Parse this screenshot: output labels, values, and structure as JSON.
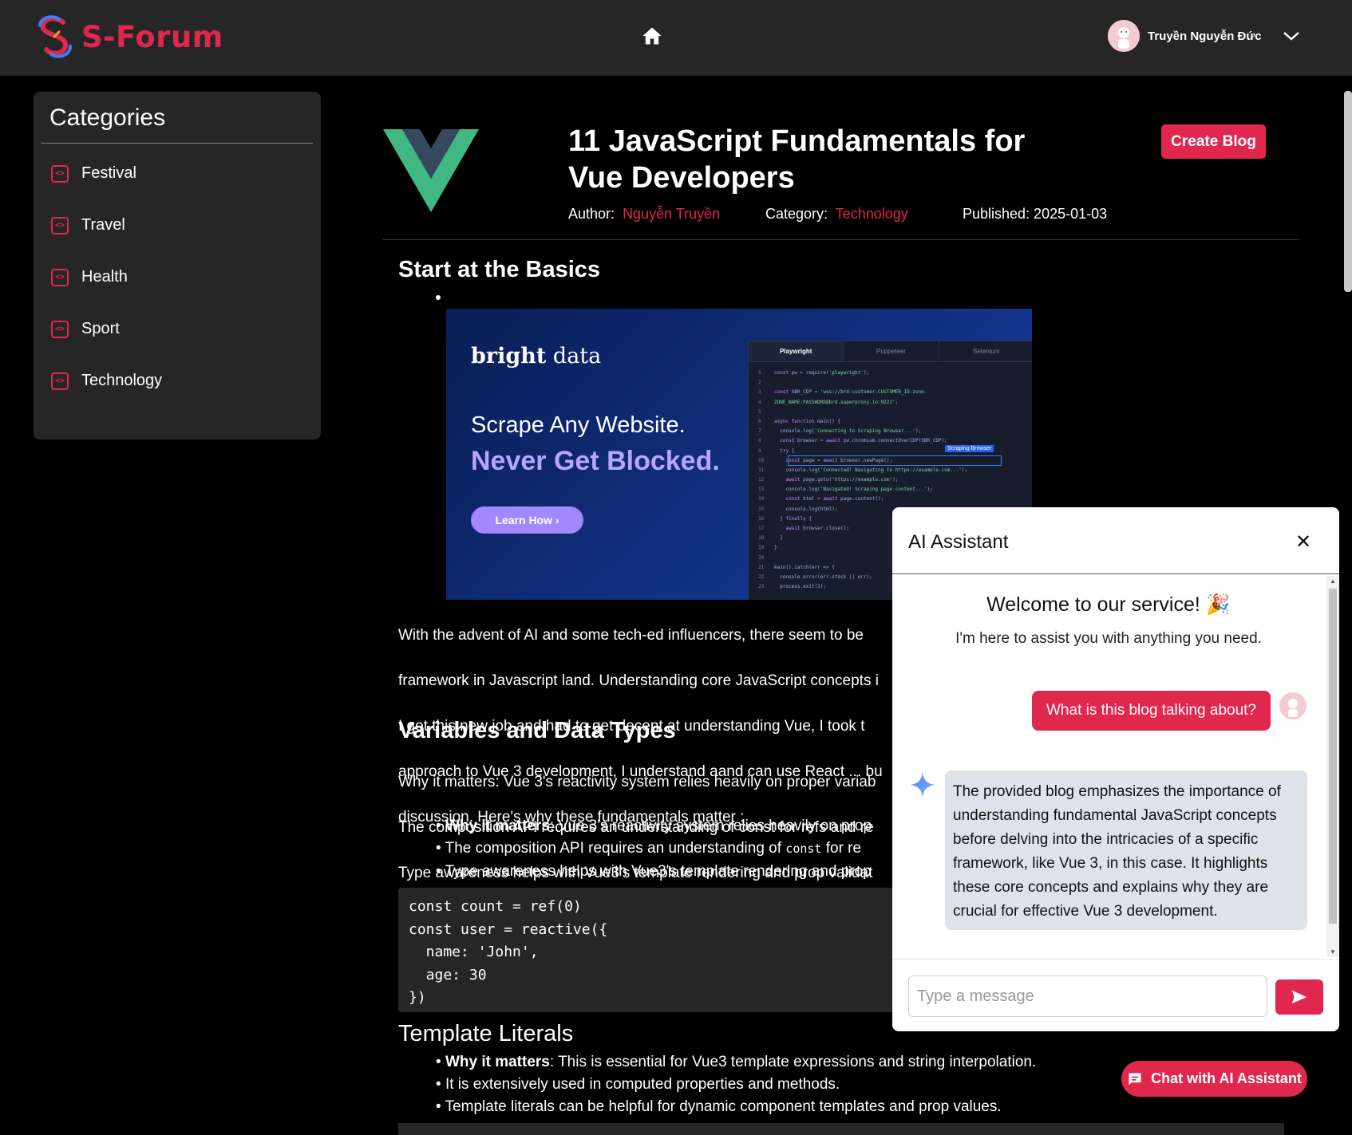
{
  "app": {
    "name": "S-Forum",
    "brand_color": "#e0284f"
  },
  "header": {
    "home_icon": "home-icon",
    "user_name": "Truyền Nguyễn Đức",
    "dropdown_icon": "chevron-down-icon"
  },
  "sidebar": {
    "title": "Categories",
    "items": [
      {
        "label": "Festival",
        "icon": "code-icon"
      },
      {
        "label": "Travel",
        "icon": "code-icon"
      },
      {
        "label": "Health",
        "icon": "code-icon"
      },
      {
        "label": "Sport",
        "icon": "code-icon"
      },
      {
        "label": "Technology",
        "icon": "code-icon"
      }
    ]
  },
  "post": {
    "title": "11 JavaScript Fundamentals for Vue Developers",
    "create_label": "Create Blog",
    "author_label": "Author:",
    "author": "Nguyễn Truyền",
    "category_label": "Category:",
    "category": "Technology",
    "published": "Published: 2025-01-03"
  },
  "content": {
    "h_basics": "Start at the Basics",
    "banner": {
      "brand_bold": "bright",
      "brand_light": " data",
      "line1": "Scrape Any Website.",
      "line2": "Never Get Blocked.",
      "cta": "Learn How ›",
      "tabs": [
        "Playwright",
        "Puppeteer",
        "Selenium"
      ],
      "highlight_tag": "Scraping Browser"
    },
    "intro_lines": [
      "With the advent of AI and some tech-ed influencers, there seem to be",
      "framework in Javascript land. Understanding core JavaScript concepts i",
      "I got this new job and had to get decent at understanding Vue, I took t",
      "approach to Vue 3 development, I understand aand can use React ... bu",
      "discussion. Here's why these fundamentals matter :"
    ],
    "h_variables": "Variables and Data Types",
    "var_lines": [
      "Why it matters: Vue 3's reactivity system relies heavily on proper variab",
      "The composition API requires an understanding of const for refs and re",
      "Type awareness helps with Vue3's template rendering and prop validat"
    ],
    "var_list": {
      "b1_bold": "Why it matters",
      "b1_rest": ": Vue 3's reactivity system relies heavily on prop",
      "b2_pre": "The composition API requires an understanding of ",
      "b2_code": "const",
      "b2_post": " for re",
      "b3": "Type awareness helps with Vue3's template rendering and prop"
    },
    "code1": "const count = ref(0)\nconst user = reactive({\n  name: 'John',\n  age: 30\n})",
    "h_template": "Template Literals",
    "tpl_list": {
      "b1_bold": "Why it matters",
      "b1_rest": ": This is essential for Vue3 template expressions and string interpolation.",
      "b2": "It is extensively used in computed properties and methods.",
      "b3": "Template literals can be helpful for dynamic component templates and prop values."
    }
  },
  "chat": {
    "title": "AI Assistant",
    "close_icon": "close-icon",
    "welcome": "Welcome to our service! 🎉",
    "welcome_sub": "I'm here to assist you with anything you need.",
    "user_message": "What is this blog talking about?",
    "bot_message": "The provided blog emphasizes the importance of understanding fundamental JavaScript concepts before delving into the intricacies of a specific framework, like Vue 3, in this case. It highlights these core concepts and explains why they are crucial for effective Vue 3 development.",
    "input_placeholder": "Type a message",
    "send_icon": "send-icon",
    "fab_label": "Chat with AI Assistant",
    "fab_icon": "chat-icon"
  }
}
